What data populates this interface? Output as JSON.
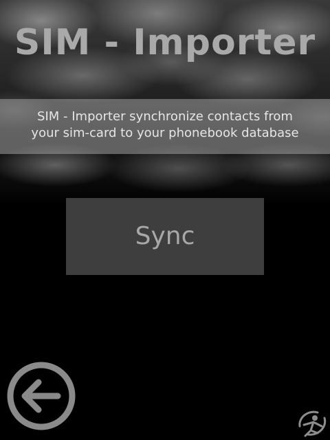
{
  "app": {
    "title": "SIM - Importer"
  },
  "description": {
    "line1": "SIM - Importer synchronize contacts from",
    "line2": "your sim-card to your phonebook database"
  },
  "actions": {
    "sync_label": "Sync"
  },
  "icons": {
    "back": "arrow-left-in-circle",
    "corner_logo": "stylized-figure-logo"
  },
  "colors": {
    "background": "#000000",
    "title": "#a9a9a9",
    "button_bg": "#3d3e3d",
    "button_text": "#a8a8a8",
    "icon": "#8a8a8a"
  }
}
